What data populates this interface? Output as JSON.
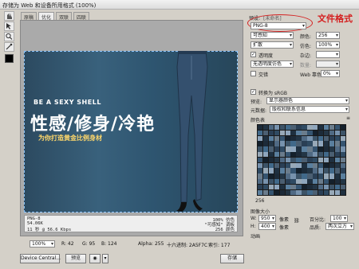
{
  "window": {
    "title": "存储为 Web 和设备所用格式 (100%)"
  },
  "view_tabs": [
    "原稿",
    "优化",
    "双联",
    "四联"
  ],
  "image": {
    "headline": "BE A SEXY SHELL",
    "big_text": "性感/修身/冷艳",
    "sub_text": "为你打造黄金比例身材"
  },
  "info_left": [
    "PNG-8",
    "54.06K",
    "11 秒 @ 56.6 Kbps"
  ],
  "info_right": [
    "100% 仿色",
    "\"可感知\" 调板",
    "256 颜色"
  ],
  "panel": {
    "preset_label": "预设:",
    "preset_value": "[未命名]",
    "format_value": "PNG-8",
    "annotation": "文件格式",
    "reduction": "可感知",
    "colors_label": "颜色:",
    "colors_value": "256",
    "dither": "扩散",
    "dither_amount_label": "仿色:",
    "dither_amount_value": "100%",
    "transparency_label": "透明度",
    "matte_label": "杂边:",
    "transparency_dither": "无透明度仿色",
    "amount_label": "数量:",
    "interlaced_label": "交错",
    "web_snap_label": "Web 靠色:",
    "web_snap_value": "0%",
    "convert_srgb": "转换为 sRGB",
    "preview_label": "预览:",
    "preview_value": "显示器颜色",
    "metadata_label": "元数据:",
    "metadata_value": "版权和联系信息",
    "color_table_label": "颜色表",
    "color_count": "256",
    "image_size_label": "图像大小",
    "w_label": "W:",
    "w_value": "950",
    "h_label": "H:",
    "h_value": "400",
    "px_unit": "像素",
    "percent_label": "百分比:",
    "percent_value": "100",
    "quality_label": "品质:",
    "quality_value": "两次立方",
    "animation_label": "动画"
  },
  "status": {
    "zoom": "100%",
    "r": "R: 42",
    "g": "G: 95",
    "b": "B: 124",
    "alpha": "Alpha: 255",
    "hex": "十六进制: 2A5F7C",
    "index": "索引: 177"
  },
  "footer": {
    "device_central": "Device Central...",
    "preview": "预览",
    "save": "存储"
  },
  "colors": {
    "annotation_red": "#d42020",
    "preview_blue": "#2c4a60",
    "text_yellow": "#ffd86b"
  }
}
